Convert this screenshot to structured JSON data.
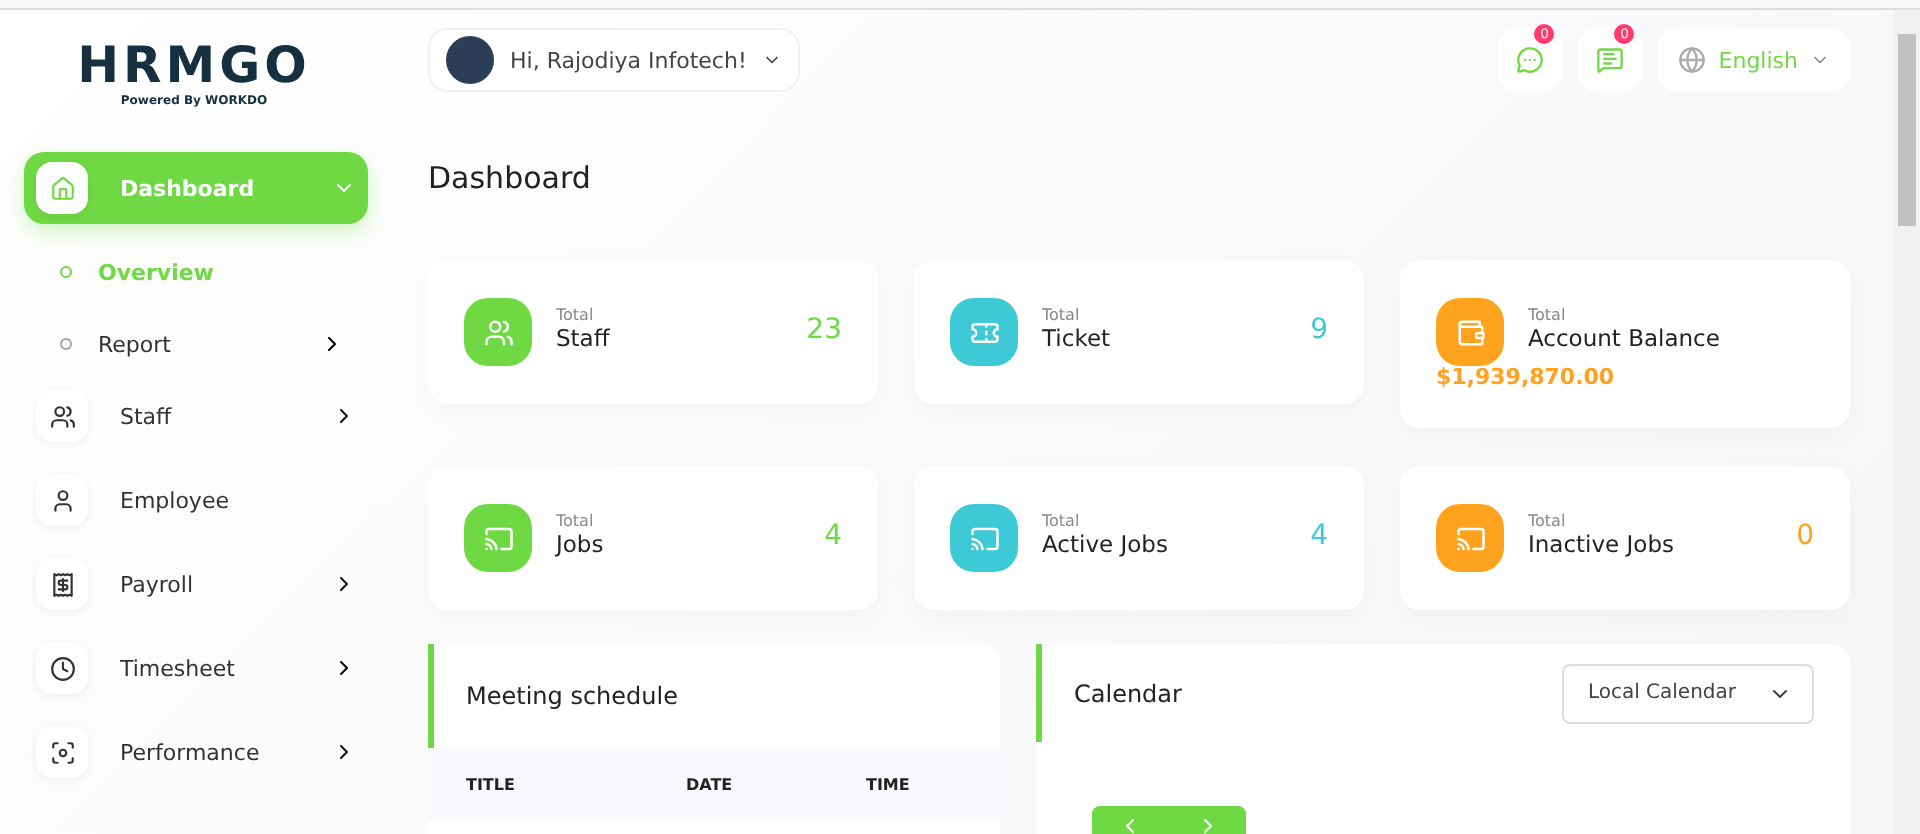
{
  "logo": {
    "name": "HRMGO",
    "tagline": "Powered By WORKDO"
  },
  "header": {
    "greeting": "Hi, Rajodiya Infotech!",
    "notifications": [
      {
        "count": "0"
      },
      {
        "count": "0"
      }
    ],
    "language": "English"
  },
  "sidebar": {
    "items": [
      {
        "label": "Dashboard",
        "kind": "group",
        "selected": true,
        "expanded": true,
        "children": [
          {
            "label": "Overview",
            "kind": "link",
            "selected": true
          },
          {
            "label": "Report",
            "kind": "group",
            "selected": false,
            "expanded": false
          }
        ]
      },
      {
        "label": "Staff",
        "kind": "group",
        "selected": false,
        "expanded": false
      },
      {
        "label": "Employee",
        "kind": "link",
        "selected": false
      },
      {
        "label": "Payroll",
        "kind": "group",
        "selected": false,
        "expanded": false
      },
      {
        "label": "Timesheet",
        "kind": "group",
        "selected": false,
        "expanded": false
      },
      {
        "label": "Performance",
        "kind": "group",
        "selected": false,
        "expanded": false
      }
    ]
  },
  "page_title": "Dashboard",
  "stats": [
    {
      "kind": "count",
      "caption": "Total",
      "label": "Staff",
      "value": "23",
      "color": "#6fd943"
    },
    {
      "kind": "count",
      "caption": "Total",
      "label": "Ticket",
      "value": "9",
      "color": "#3ec9d6"
    },
    {
      "kind": "balance",
      "caption": "Total",
      "label": "Account Balance",
      "value": "$1,939,870.00",
      "color": "#ffa21d"
    },
    {
      "kind": "count",
      "caption": "Total",
      "label": "Jobs",
      "value": "4",
      "color": "#6fd943"
    },
    {
      "kind": "count",
      "caption": "Total",
      "label": "Active Jobs",
      "value": "4",
      "color": "#3ec9d6"
    },
    {
      "kind": "count",
      "caption": "Total",
      "label": "Inactive Jobs",
      "value": "0",
      "color": "#ffa21d"
    }
  ],
  "meeting_schedule": {
    "title": "Meeting schedule",
    "columns": [
      "TITLE",
      "DATE",
      "TIME"
    ]
  },
  "calendar": {
    "title": "Calendar",
    "select": "Local Calendar"
  }
}
